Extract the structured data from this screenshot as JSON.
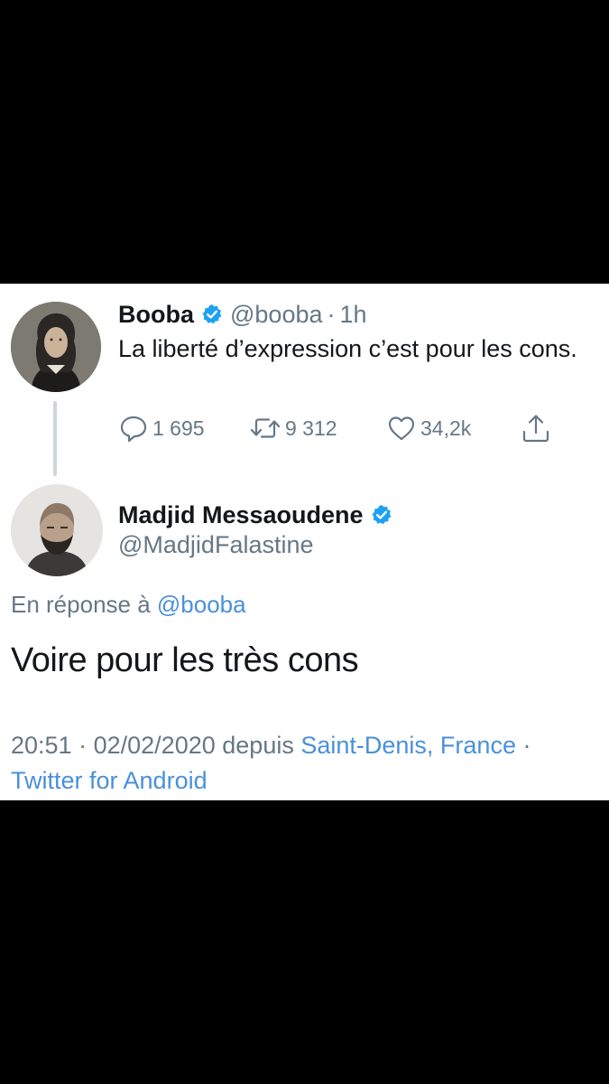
{
  "colors": {
    "background": "#000000",
    "card": "#ffffff",
    "text": "#14171a",
    "muted": "#657786",
    "link": "#4a90d9",
    "verified": "#1da1f2",
    "thread_line": "#cdd6df"
  },
  "tweet1": {
    "name": "Booba",
    "handle": "@booba",
    "separator": "·",
    "time": "1h",
    "text": "La liberté d’expression c’est pour les cons.",
    "avatar_icon": "portrait-avatar",
    "actions": {
      "replies": "1 695",
      "retweets": "9 312",
      "likes": "34,2k",
      "reply_icon": "comment-icon",
      "retweet_icon": "retweet-icon",
      "like_icon": "heart-icon",
      "share_icon": "share-icon"
    }
  },
  "tweet2": {
    "name": "Madjid Messaoudene",
    "handle": "@MadjidFalastine",
    "avatar_icon": "photo-avatar",
    "reply_prefix": "En réponse à",
    "reply_to": "@booba",
    "text": "Voire pour les très cons",
    "meta": {
      "time": "20:51",
      "sep1": "·",
      "date": "02/02/2020",
      "from_word": "depuis",
      "location": "Saint-Denis, France",
      "sep2": "·",
      "client": "Twitter for Android"
    }
  }
}
